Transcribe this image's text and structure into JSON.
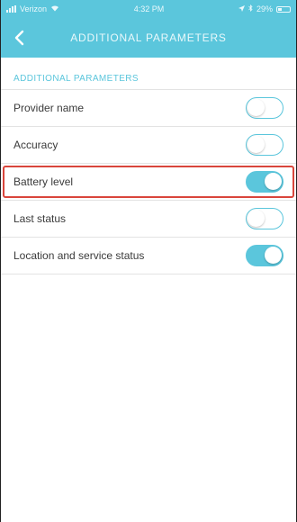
{
  "status_bar": {
    "carrier": "Verizon",
    "time": "4:32 PM",
    "battery_percent": "29%"
  },
  "nav": {
    "title": "ADDITIONAL PARAMETERS",
    "back_icon": "chevron-left-icon"
  },
  "section": {
    "header": "ADDITIONAL PARAMETERS"
  },
  "items": [
    {
      "label": "Provider name",
      "enabled": false,
      "highlighted": false
    },
    {
      "label": "Accuracy",
      "enabled": false,
      "highlighted": false
    },
    {
      "label": "Battery level",
      "enabled": true,
      "highlighted": true
    },
    {
      "label": "Last status",
      "enabled": false,
      "highlighted": false
    },
    {
      "label": "Location and service status",
      "enabled": true,
      "highlighted": false
    }
  ],
  "colors": {
    "accent": "#5bc6dc",
    "highlight": "#d9453b"
  }
}
